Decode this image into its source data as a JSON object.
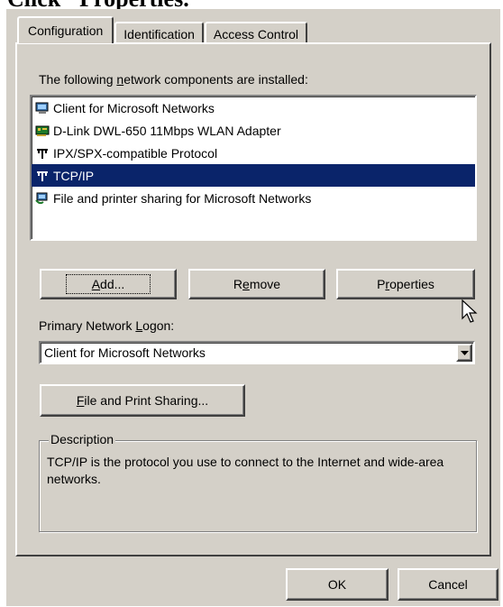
{
  "heading": "Click \"Properties.\"",
  "tabs": [
    {
      "label": "Configuration",
      "active": true
    },
    {
      "label": "Identification",
      "active": false
    },
    {
      "label": "Access Control",
      "active": false
    }
  ],
  "components_label_pre": "The following ",
  "components_label_key": "n",
  "components_label_post": "etwork components are installed:",
  "components": [
    {
      "label": "Client for Microsoft Networks",
      "icon": "network-client-icon",
      "selected": false
    },
    {
      "label": "D-Link DWL-650 11Mbps WLAN Adapter",
      "icon": "network-adapter-icon",
      "selected": false
    },
    {
      "label": "IPX/SPX-compatible Protocol",
      "icon": "protocol-icon",
      "selected": false
    },
    {
      "label": "TCP/IP",
      "icon": "protocol-icon",
      "selected": true
    },
    {
      "label": "File and printer sharing for Microsoft Networks",
      "icon": "file-sharing-icon",
      "selected": false
    }
  ],
  "buttons": {
    "add_key": "A",
    "add_rest": "dd...",
    "remove_pre": "R",
    "remove_key": "e",
    "remove_post": "move",
    "properties_pre": "P",
    "properties_key": "r",
    "properties_post": "operties",
    "file_print_key": "F",
    "file_print_rest": "ile and Print Sharing...",
    "ok": "OK",
    "cancel": "Cancel"
  },
  "logon": {
    "label_pre": "Primary Network ",
    "label_key": "L",
    "label_post": "ogon:",
    "value": "Client for Microsoft Networks"
  },
  "description": {
    "title": "Description",
    "text": "TCP/IP is the protocol you use to connect to the Internet and wide-area networks."
  },
  "colors": {
    "dialog_bg": "#d4d0c8",
    "selection": "#0a246a"
  }
}
